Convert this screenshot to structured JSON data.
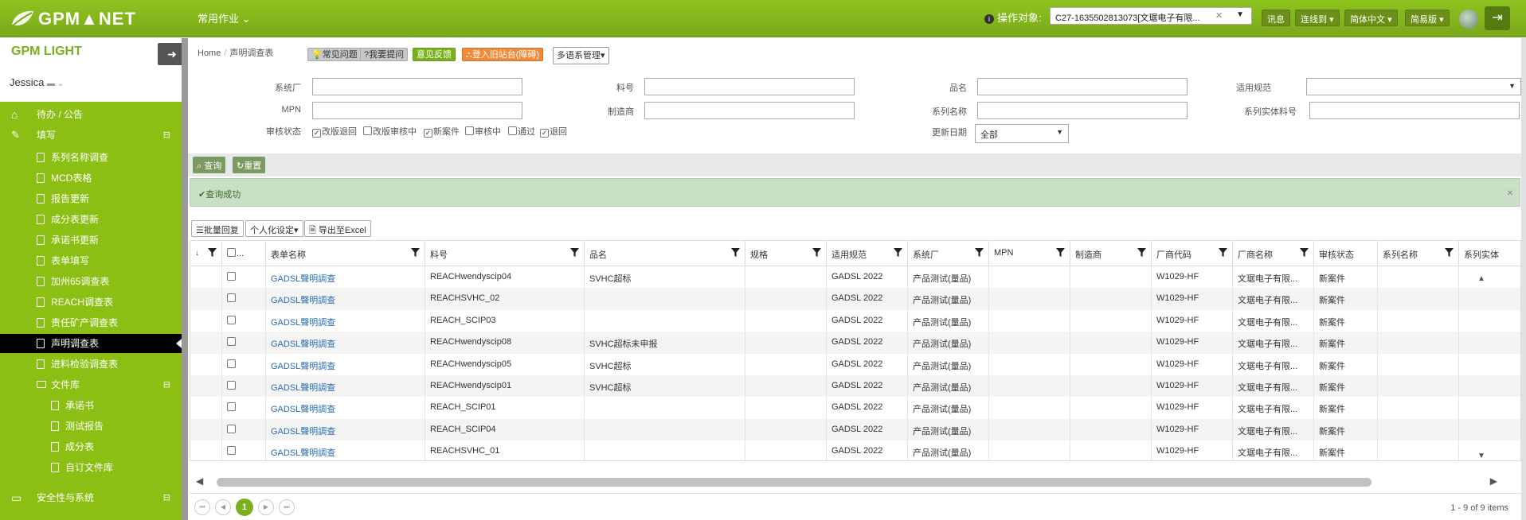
{
  "header": {
    "logo_text": "GPM▲NET",
    "main_menu": "常用作业",
    "operate_label": "操作对象:",
    "operate_value": "C27-1635502813073[文琚电子有限...",
    "buttons": [
      "讯息",
      "连线到",
      "简体中文",
      "简易版"
    ]
  },
  "sidebar": {
    "logo_text": "GPM LIGHT",
    "user": "Jessica",
    "items": [
      {
        "label": "待办 / 公告",
        "level": 0
      },
      {
        "label": "填写",
        "level": 0,
        "expanded": true
      },
      {
        "label": "系列名称调查",
        "level": 1
      },
      {
        "label": "MCD表格",
        "level": 1
      },
      {
        "label": "报告更新",
        "level": 1
      },
      {
        "label": "成分表更新",
        "level": 1
      },
      {
        "label": "承诺书更新",
        "level": 1
      },
      {
        "label": "表单填写",
        "level": 1
      },
      {
        "label": "加州65调查表",
        "level": 1
      },
      {
        "label": "REACH调查表",
        "level": 1
      },
      {
        "label": "责任矿产调查表",
        "level": 1
      },
      {
        "label": "声明调查表",
        "level": 1,
        "active": true
      },
      {
        "label": "进料检验调查表",
        "level": 1
      },
      {
        "label": "文件库",
        "level": 1,
        "folder": true
      },
      {
        "label": "承诺书",
        "level": 2
      },
      {
        "label": "测试报告",
        "level": 2
      },
      {
        "label": "成分表",
        "level": 2
      },
      {
        "label": "自订文件库",
        "level": 2
      },
      {
        "label": "安全性与系统",
        "level": 0
      }
    ]
  },
  "breadcrumb": {
    "home": "Home",
    "current": "声明调查表"
  },
  "help_buttons": {
    "faq": "常见问题",
    "ask": "我要提问",
    "feedback": "意见反馈",
    "old_login": "登入旧站台(障碍)",
    "multi_lang": "多语系管理"
  },
  "filters": {
    "system_factory": "系统厂",
    "part_no": "料号",
    "product_name": "品名",
    "spec_applicable": "适用规范",
    "mpn": "MPN",
    "manufacturer": "制造商",
    "series_name": "系列名称",
    "series_entity_no": "系列实体料号",
    "review_status": "审核状态",
    "update_date": "更新日期",
    "update_date_value": "全部",
    "status_options": [
      {
        "label": "改版退回",
        "checked": true
      },
      {
        "label": "改版审核中",
        "checked": false
      },
      {
        "label": "新案件",
        "checked": true
      },
      {
        "label": "审核中",
        "checked": false
      },
      {
        "label": "通过",
        "checked": false
      },
      {
        "label": "退回",
        "checked": true
      }
    ]
  },
  "actions": {
    "query": "查询",
    "reset": "重置"
  },
  "alert": {
    "message": "查询成功"
  },
  "grid_toolbar": {
    "batch_reply": "批量回复",
    "personalize": "个人化设定",
    "export": "导出至Excel"
  },
  "grid": {
    "columns": [
      "",
      "...",
      "表单名称",
      "料号",
      "品名",
      "规格",
      "适用规范",
      "系统厂",
      "MPN",
      "制造商",
      "厂商代码",
      "厂商名称",
      "审核状态",
      "系列名称",
      "系列实体"
    ],
    "rows": [
      [
        "GADSL聲明調查",
        "REACHwendyscip04",
        "SVHC超标",
        "",
        "GADSL 2022",
        "产品测试(量品)",
        "",
        "",
        "W1029-HF",
        "文琚电子有限...",
        "新案件"
      ],
      [
        "GADSL聲明調查",
        "REACHSVHC_02",
        "",
        "",
        "GADSL 2022",
        "产品测试(量品)",
        "",
        "",
        "W1029-HF",
        "文琚电子有限...",
        "新案件"
      ],
      [
        "GADSL聲明調查",
        "REACH_SCIP03",
        "",
        "",
        "GADSL 2022",
        "产品测试(量品)",
        "",
        "",
        "W1029-HF",
        "文琚电子有限...",
        "新案件"
      ],
      [
        "GADSL聲明調查",
        "REACHwendyscip08",
        "SVHC超标未申报",
        "",
        "GADSL 2022",
        "产品测试(量品)",
        "",
        "",
        "W1029-HF",
        "文琚电子有限...",
        "新案件"
      ],
      [
        "GADSL聲明調查",
        "REACHwendyscip05",
        "SVHC超标",
        "",
        "GADSL 2022",
        "产品测试(量品)",
        "",
        "",
        "W1029-HF",
        "文琚电子有限...",
        "新案件"
      ],
      [
        "GADSL聲明調查",
        "REACHwendyscip01",
        "SVHC超标",
        "",
        "GADSL 2022",
        "产品测试(量品)",
        "",
        "",
        "W1029-HF",
        "文琚电子有限...",
        "新案件"
      ],
      [
        "GADSL聲明調查",
        "REACH_SCIP01",
        "",
        "",
        "GADSL 2022",
        "产品测试(量品)",
        "",
        "",
        "W1029-HF",
        "文琚电子有限...",
        "新案件"
      ],
      [
        "GADSL聲明調查",
        "REACH_SCIP04",
        "",
        "",
        "GADSL 2022",
        "产品测试(量品)",
        "",
        "",
        "W1029-HF",
        "文琚电子有限...",
        "新案件"
      ],
      [
        "GADSL聲明調查",
        "REACHSVHC_01",
        "",
        "",
        "GADSL 2022",
        "产品测试(量品)",
        "",
        "",
        "W1029-HF",
        "文琚电子有限...",
        "新案件"
      ]
    ]
  },
  "pager": {
    "current": "1",
    "info": "1 - 9 of 9 items"
  },
  "colors": {
    "brand_green": "#8cbf14",
    "active_black": "#000000",
    "alert_bg": "#c9dfc6",
    "link_blue": "#2a6cb0"
  }
}
